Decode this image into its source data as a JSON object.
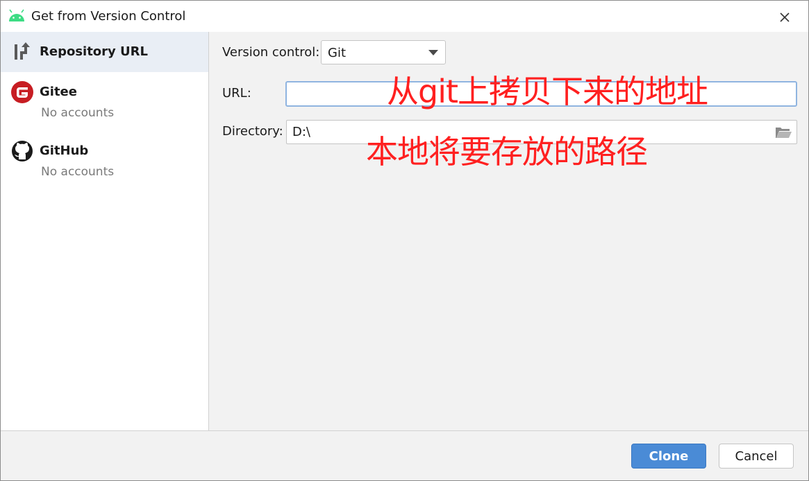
{
  "window": {
    "title": "Get from Version Control",
    "app_icon": "android-icon",
    "close_icon": "close-icon"
  },
  "sidebar": {
    "items": [
      {
        "label": "Repository URL",
        "icon": "repository-url-icon",
        "selected": true
      },
      {
        "label": "Gitee",
        "sub": "No accounts",
        "icon": "gitee-icon"
      },
      {
        "label": "GitHub",
        "sub": "No accounts",
        "icon": "github-icon"
      }
    ]
  },
  "form": {
    "vcs_label": "Version control:",
    "vcs_value": "Git",
    "url_label": "URL:",
    "url_value": "",
    "dir_label": "Directory:",
    "dir_value": "D:\\",
    "folder_icon": "folder-open-icon"
  },
  "annotations": {
    "url_note": "从git上拷贝下来的地址",
    "dir_note": "本地将要存放的路径",
    "color": "#ff2020"
  },
  "footer": {
    "clone_label": "Clone",
    "cancel_label": "Cancel"
  },
  "colors": {
    "primary": "#4a8bd6",
    "selected_bg": "#e9eef5",
    "focus_border": "#8fb4e0"
  }
}
